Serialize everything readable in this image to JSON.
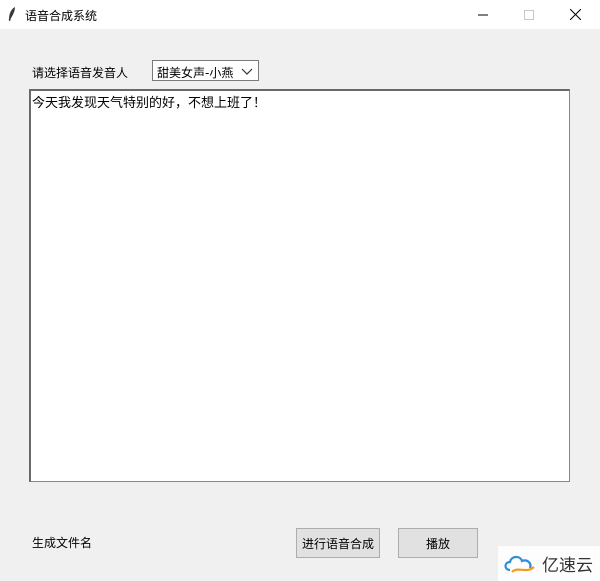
{
  "window": {
    "title": "语音合成系统"
  },
  "form": {
    "voice_label": "请选择语音发音人",
    "voice_selected": "甜美女声-小燕",
    "text_content": "今天我发现天气特别的好，不想上班了！",
    "filename_label": "生成文件名"
  },
  "buttons": {
    "synthesize": "进行语音合成",
    "play": "播放"
  },
  "watermark": {
    "text": "亿速云"
  }
}
